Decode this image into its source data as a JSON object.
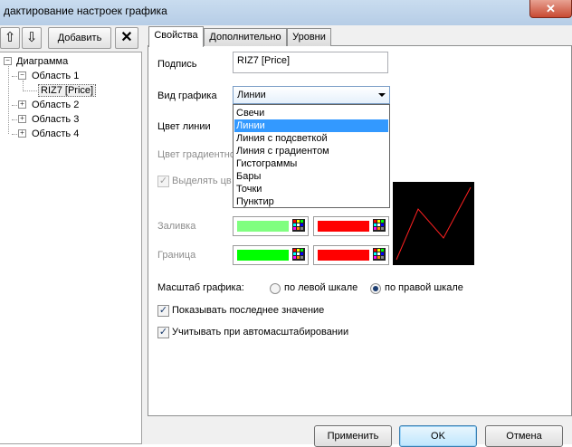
{
  "window": {
    "title": "дактирование настроек графика",
    "close_label": "✕"
  },
  "toolbar": {
    "up_icon": "⇧",
    "down_icon": "⇩",
    "add_label": "Добавить",
    "delete_icon": "✕"
  },
  "tree": {
    "root": "Диаграмма",
    "areas": [
      "Область 1",
      "Область 2",
      "Область 3",
      "Область 4"
    ],
    "series": "RIZ7 [Price]"
  },
  "tabs": [
    "Свойства",
    "Дополнительно",
    "Уровни"
  ],
  "props": {
    "caption_label": "Подпись",
    "caption_value": "RIZ7 [Price]",
    "chart_type_label": "Вид графика",
    "chart_type_value": "Линии",
    "chart_type_options": [
      "Свечи",
      "Линии",
      "Линия с подсветкой",
      "Линия с градиентом",
      "Гистограммы",
      "Бары",
      "Точки",
      "Пунктир"
    ],
    "line_color_label": "Цвет линии",
    "gradient_color_label": "Цвет градиентно",
    "highlight_label": "Выделять цв",
    "fill_label": "Заливка",
    "border_label": "Граница",
    "scale_label": "Масштаб графика:",
    "scale_left": "по левой шкале",
    "scale_right": "по правой шкале",
    "show_last_label": "Показывать последнее значение",
    "autoscale_label": "Учитывать при автомасштабировании"
  },
  "colors": {
    "fill_up": "#80ff80",
    "fill_down": "#ff0000",
    "border_up": "#00ff00",
    "border_down": "#ff0000",
    "preview_line": "#ff2020",
    "accent": "#3399ff"
  },
  "buttons": {
    "apply": "Применить",
    "ok": "OK",
    "cancel": "Отмена"
  }
}
